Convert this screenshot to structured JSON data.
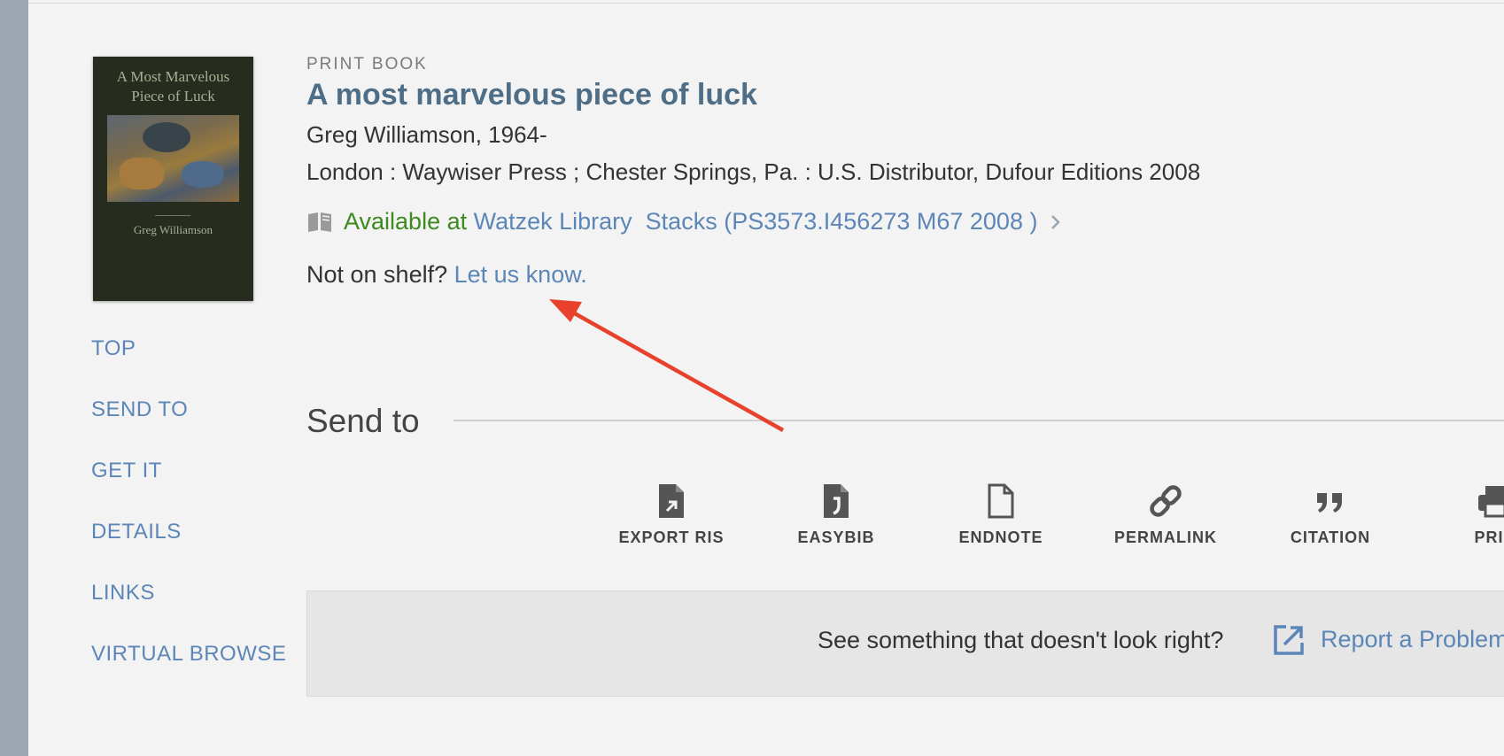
{
  "record": {
    "format": "PRINT BOOK",
    "title": "A most marvelous piece of luck",
    "author": "Greg Williamson, 1964-",
    "publication": "London : Waywiser Press ; Chester Springs, Pa. : U.S. Distributor, Dufour Editions 2008",
    "cover": {
      "title_line1": "A Most Marvelous",
      "title_line2": "Piece of Luck",
      "author": "Greg Williamson"
    }
  },
  "availability": {
    "status_text": "Available at",
    "location_link": "Watzek Library  Stacks (PS3573.I456273 M67 2008 )",
    "status_color": "#3d8a1f"
  },
  "shelf_notice": {
    "question": "Not on shelf?",
    "link": "Let us know."
  },
  "side_nav": [
    "TOP",
    "SEND TO",
    "GET IT",
    "DETAILS",
    "LINKS",
    "VIRTUAL BROWSE"
  ],
  "send_to": {
    "heading": "Send to",
    "actions": [
      {
        "label": "EXPORT RIS",
        "icon": "export-ris-icon"
      },
      {
        "label": "EASYBIB",
        "icon": "easybib-icon"
      },
      {
        "label": "ENDNOTE",
        "icon": "endnote-icon"
      },
      {
        "label": "PERMALINK",
        "icon": "link-icon"
      },
      {
        "label": "CITATION",
        "icon": "quote-icon"
      },
      {
        "label": "PRIN",
        "icon": "print-icon"
      }
    ]
  },
  "report": {
    "question": "See something that doesn't look right?",
    "link": "Report a Problem"
  },
  "colors": {
    "link": "#5c86b8",
    "title": "#4d6e86",
    "annotation_arrow": "#e8412c"
  }
}
